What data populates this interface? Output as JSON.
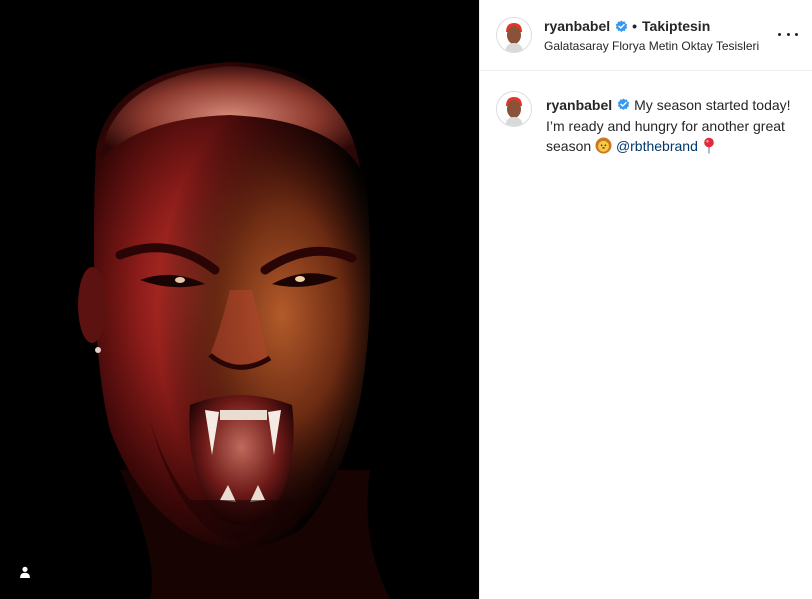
{
  "post": {
    "username": "ryanbabel",
    "verified": true,
    "separator": "•",
    "follow_status": "Takiptesin",
    "location": "Galatasaray Florya Metin Oktay Tesisleri",
    "more_icon": "more-options-icon",
    "tag_icon": "user-tag-icon"
  },
  "caption": {
    "username": "ryanbabel",
    "text_before": "My season started today! I’m ready and hungry for another great season",
    "emoji_lion": "lion-face-icon",
    "mention": "@rbthebrand",
    "emoji_pin": "round-pushpin-icon"
  },
  "colors": {
    "verified_blue": "#3897f0",
    "mention_blue": "#00376b",
    "text": "#262626"
  }
}
